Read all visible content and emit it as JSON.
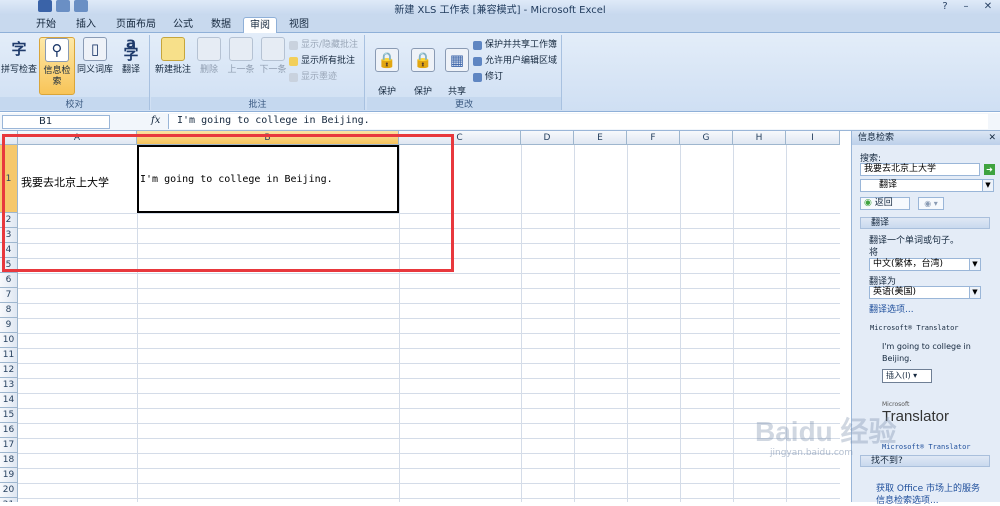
{
  "window": {
    "title": "新建 XLS 工作表 [兼容模式] - Microsoft Excel",
    "help": "?",
    "minimize": "–",
    "restore": "❐",
    "close": "✕"
  },
  "tabs": [
    {
      "label": "开始"
    },
    {
      "label": "插入"
    },
    {
      "label": "页面布局"
    },
    {
      "label": "公式"
    },
    {
      "label": "数据"
    },
    {
      "label": "审阅",
      "active": true
    },
    {
      "label": "视图"
    }
  ],
  "ribbon": {
    "proofing": {
      "label": "校对",
      "spell": "拼写检查",
      "research": "信息检索",
      "thesaurus": "同义词库",
      "translate": "翻译"
    },
    "comments": {
      "label": "批注",
      "new": "新建批注",
      "delete": "删除",
      "prev": "上一条",
      "next": "下一条",
      "show_hide": "显示/隐藏批注",
      "show_all": "显示所有批注",
      "show_ink": "显示墨迹"
    },
    "changes": {
      "label": "更改",
      "protect_sheet": "保护\n工作表",
      "protect_book": "保护\n工作簿",
      "share_book": "共享\n工作簿",
      "protect_share": "保护并共享工作簿",
      "allow_edit": "允许用户编辑区域",
      "track": "修订"
    }
  },
  "formula_bar": {
    "name_box": "B1",
    "fx": "fx",
    "value": "I'm going to college in Beijing."
  },
  "sheet": {
    "columns": [
      "A",
      "B",
      "C",
      "D",
      "E",
      "F",
      "G",
      "H",
      "I"
    ],
    "rows": [
      "1",
      "2",
      "3",
      "4",
      "5",
      "6",
      "7",
      "8",
      "9",
      "10",
      "11",
      "12",
      "13",
      "14",
      "15",
      "16",
      "17",
      "18",
      "19",
      "20",
      "21"
    ],
    "cells": {
      "A1": "我要去北京上大学",
      "B1": "I'm going to college in Beijing."
    }
  },
  "research_pane": {
    "title": "信息检索",
    "close": "✕",
    "search_label": "搜索:",
    "search_value": "我要去北京上大学",
    "service": "翻译",
    "back": "返回",
    "section_translate": "翻译",
    "translate_hint": "翻译一个单词或句子。",
    "from_label": "将",
    "from_lang": "中文(繁体，台湾)",
    "to_label": "翻译为",
    "to_lang": "英语(美国)",
    "options_link": "翻译选项...",
    "ms_translator": "Microsoft® Translator",
    "result": "I'm going to college in Beijing.",
    "insert": "插入(I)",
    "logo_ms": "Microsoft",
    "logo_tr": "Translator",
    "ms_translator2": "Microsoft® Translator",
    "not_found": "找不到?",
    "office_market": "获取 Office 市场上的服务",
    "research_options": "信息检索选项..."
  },
  "watermark": {
    "brand": "Baidu 经验",
    "url": "jingyan.baidu.com"
  },
  "colors": {
    "ribbon": "#cfdff3",
    "selected_header": "#f6c35c",
    "highlight_box": "#e8383d"
  }
}
